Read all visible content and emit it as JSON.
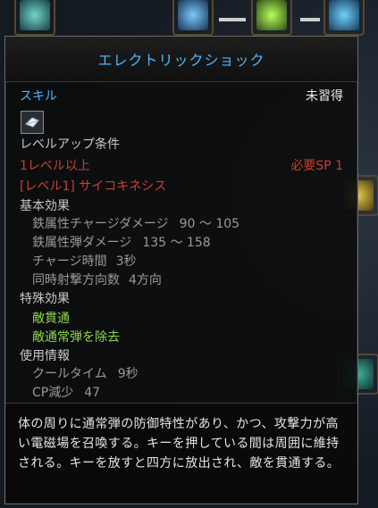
{
  "tooltip": {
    "title": "エレクトリックショック",
    "type_label": "スキル",
    "status": "未習得",
    "levelup_heading": "レベルアップ条件",
    "req_level": "1レベル以上",
    "req_sp": "必要SP 1",
    "req_skill": "[レベル1] サイコキネシス",
    "basic_heading": "基本効果",
    "basic": [
      {
        "label": "鉄属性チャージダメージ",
        "value": "90 ～ 105"
      },
      {
        "label": "鉄属性弾ダメージ",
        "value": "135 ～ 158"
      },
      {
        "label": "チャージ時間",
        "value": "3秒"
      },
      {
        "label": "同時射撃方向数",
        "value": "4方向"
      }
    ],
    "special_heading": "特殊効果",
    "special": [
      "敵貫通",
      "敵通常弾を除去"
    ],
    "usage_heading": "使用情報",
    "usage": [
      {
        "label": "クールタイム",
        "value": "9秒"
      },
      {
        "label": "CP減少",
        "value": "47"
      }
    ],
    "description": "体の周りに通常弾の防御特性があり、かつ、攻撃力が高い電磁場を召喚する。キーを押している間は周囲に維持される。キーを放すと四方に放出され、敵を貫通する。"
  },
  "colors": {
    "title": "#4fb7ff",
    "requirement_red": "#c8412f",
    "special_green": "#8ed64f"
  }
}
